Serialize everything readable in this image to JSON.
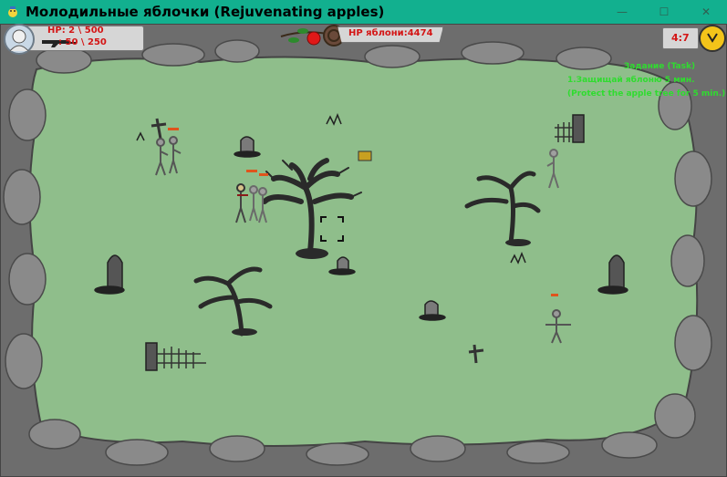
{
  "window": {
    "title": "Молодильные яблочки (Rejuvenating apples)",
    "controls": [
      "minimize-icon",
      "maximize-icon",
      "close-icon"
    ],
    "control_glyphs": [
      "—",
      "☐",
      "✕"
    ]
  },
  "hud": {
    "hp_label": "HP: 2 \\ 500",
    "ammo_label": ": 50 \\ 250",
    "apple_hp_label": "HP яблони:4474",
    "timer": "4:7"
  },
  "task": {
    "title": "Задание (Task)",
    "line1": "1.Защищай яблоню 5 мин.",
    "line2": "(Protect the apple tree for 5 min.)"
  },
  "colors": {
    "titlebar": "#12b08f",
    "grass": "#8fbe8b",
    "rock": "#6b6b6b",
    "hud_text": "#d41515",
    "task_text": "#2fdc2f",
    "enemy_hp": "#e0541c"
  },
  "icons": [
    "game-app-icon",
    "player-avatar-icon",
    "rifle-icon",
    "apple-branch-icon",
    "clock-icon"
  ]
}
